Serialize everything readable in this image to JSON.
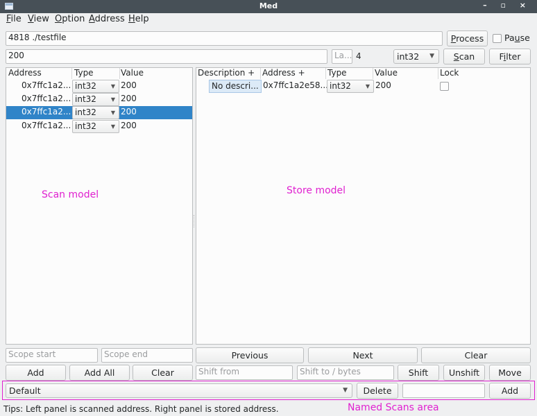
{
  "window": {
    "title": "Med",
    "controls": "– ▫ ×"
  },
  "menu": [
    {
      "label": "File",
      "accel": "F",
      "rest": "ile"
    },
    {
      "label": "View",
      "accel": "V",
      "rest": "iew"
    },
    {
      "label": "Option",
      "accel": "O",
      "rest": "ption"
    },
    {
      "label": "Address",
      "accel": "A",
      "rest": "ddress"
    },
    {
      "label": "Help",
      "accel": "H",
      "rest": "elp"
    }
  ],
  "process": {
    "value": "4818 ./testfile",
    "button_accel": "P",
    "button_rest": "rocess",
    "pause_label_pre": "Pa",
    "pause_accel": "u",
    "pause_label_post": "se"
  },
  "scan_bar": {
    "value": "200",
    "last_placeholder": "La...",
    "size": "4",
    "type": "int32",
    "scan_accel": "S",
    "scan_rest": "can",
    "filter_pre": "F",
    "filter_accel": "i",
    "filter_post": "lter"
  },
  "scan_panel": {
    "headers": [
      "Address",
      "Type",
      "Value"
    ],
    "rows": [
      {
        "address": "0x7ffc1a2...",
        "type": "int32",
        "value": "200",
        "selected": false
      },
      {
        "address": "0x7ffc1a2...",
        "type": "int32",
        "value": "200",
        "selected": false
      },
      {
        "address": "0x7ffc1a2...",
        "type": "int32",
        "value": "200",
        "selected": true
      },
      {
        "address": "0x7ffc1a2...",
        "type": "int32",
        "value": "200",
        "selected": false
      }
    ],
    "annotation": "Scan model"
  },
  "store_panel": {
    "headers": [
      "Description +",
      "Address +",
      "Type",
      "Value",
      "Lock"
    ],
    "rows": [
      {
        "description": "No descri...",
        "address": "0x7ffc1a2e58...",
        "type": "int32",
        "value": "200",
        "lock": false
      }
    ],
    "annotation": "Store model"
  },
  "scope": {
    "start_placeholder": "Scope start",
    "end_placeholder": "Scope end"
  },
  "store_nav": {
    "previous": "Previous",
    "next": "Next",
    "clear": "Clear"
  },
  "scan_actions": {
    "add": "Add",
    "add_all": "Add All",
    "clear": "Clear"
  },
  "shift": {
    "from_placeholder": "Shift from",
    "to_placeholder": "Shift to / bytes",
    "shift": "Shift",
    "unshift": "Unshift",
    "move": "Move"
  },
  "named_scans": {
    "selected": "Default",
    "delete": "Delete",
    "name_value": "",
    "add": "Add",
    "annotation": "Named Scans area"
  },
  "tips": "Tips: Left panel is scanned address. Right panel is stored address."
}
